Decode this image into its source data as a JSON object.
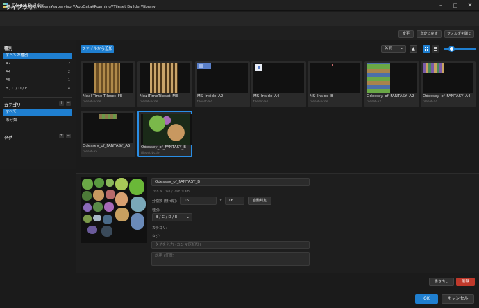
{
  "window": {
    "title": "Tileset Builder",
    "controls": [
      "minimize",
      "maximize",
      "close"
    ]
  },
  "page": {
    "title": "ライブラリ"
  },
  "library_path": {
    "label": "ライブラリの場所:",
    "value": "C:¥Users¥supervisor¥AppData¥Roaming¥Tileset Builder¥library",
    "buttons": {
      "change": "変更",
      "reset": "既定に戻す",
      "open_folder": "フォルダを開く"
    }
  },
  "sidebar": {
    "type_heading": "種別",
    "types": [
      {
        "label": "すべての種別",
        "count": "",
        "selected": true
      },
      {
        "label": "A2",
        "count": "2"
      },
      {
        "label": "A4",
        "count": "2"
      },
      {
        "label": "A5",
        "count": "1"
      },
      {
        "label": "B / C / D / E",
        "count": "4"
      }
    ],
    "category_heading": "カテゴリ",
    "categories": [
      {
        "label": "すべて",
        "selected": true
      },
      {
        "label": "未分類"
      }
    ],
    "tag_heading": "タグ"
  },
  "toolbar": {
    "add_file": "ファイルから追加",
    "sort": "名前",
    "sort_dir_icon": "triangle-up",
    "view_mode": "grid",
    "zoom_level": 0.15
  },
  "tilesets": [
    {
      "name": "Meal Time Tileset_FE",
      "type": "tileset-bcde"
    },
    {
      "name": "MealTimeTileset_ME",
      "type": "tileset-bcde"
    },
    {
      "name": "MS_Inside_A2",
      "type": "tileset-a2"
    },
    {
      "name": "MS_Inside_A4",
      "type": "tileset-a4"
    },
    {
      "name": "MS_Inside_B",
      "type": "tileset-bcde"
    },
    {
      "name": "Odessey_of_FANTASY_A2",
      "type": "tileset-a2"
    },
    {
      "name": "Odessey_of_FANTASY_A4",
      "type": "tileset-a4"
    },
    {
      "name": "Odessey_of_FANTASY_A5",
      "type": "tileset-a5"
    },
    {
      "name": "Odessey_of_FANTASY_B",
      "type": "tileset-bcde",
      "selected": true
    }
  ],
  "detail": {
    "name": "Odessey_of_FANTASY_B",
    "meta": "768 × 768 / 798.9 KB",
    "split_label": "分割数 (横×縦):",
    "split_x": "16",
    "split_sep": "×",
    "split_y": "16",
    "auto_detect": "自動判定",
    "type_label": "種別:",
    "type_value": "B / C / D / E",
    "category_label": "カテゴリ:",
    "tag_label": "タグ:",
    "tag_placeholder": "タグを入力 (カンマ区切り)",
    "description_placeholder": "説明 (任意)"
  },
  "footer": {
    "export": "書き出し",
    "delete": "削除",
    "ok": "OK",
    "cancel": "キャンセル"
  },
  "colors": {
    "accent": "#1f7fd0",
    "danger": "#c0392b",
    "background": "#1b1b1b"
  }
}
